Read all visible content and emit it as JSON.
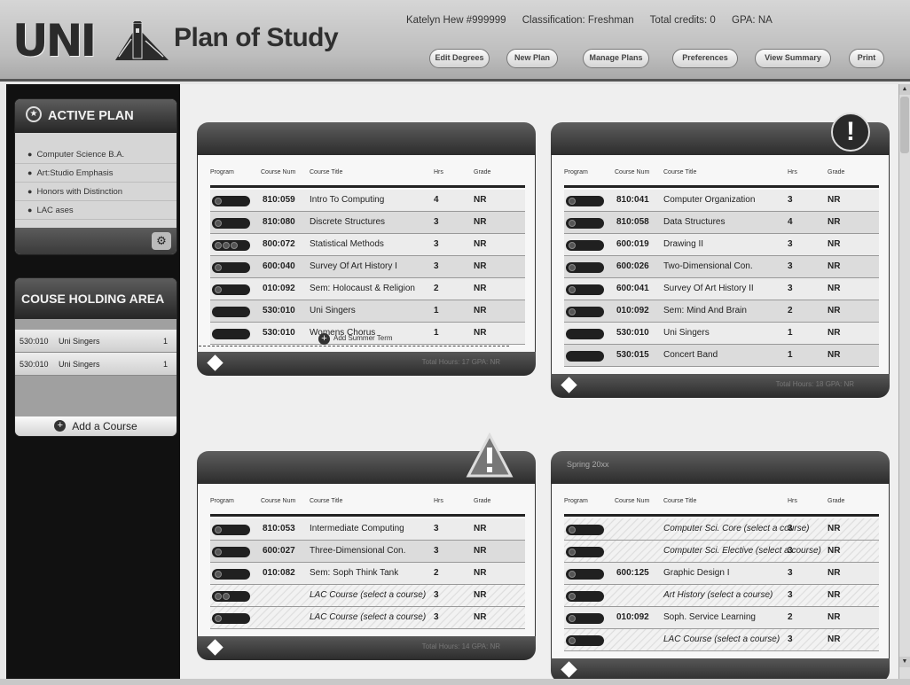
{
  "header": {
    "logo_text": "UNI",
    "title": "Plan of Study",
    "user": {
      "name": "Katelyn Hew #999999",
      "classification": "Classification: Freshman",
      "credits": "Total credits: 0",
      "gpa": "GPA: NA"
    },
    "nav": [
      "Edit Degrees",
      "New Plan",
      "Manage Plans",
      "Preferences",
      "View Summary",
      "Print"
    ]
  },
  "sidebar": {
    "active_plan": {
      "title": "ACTIVE PLAN",
      "items": [
        "Computer Science B.A.",
        "Art:Studio Emphasis",
        "Honors with Distinction",
        "LAC ases"
      ]
    },
    "holding": {
      "title": "COUSE HOLDING AREA",
      "items": [
        {
          "num": "530:010",
          "title": "Uni Singers",
          "hrs": "1"
        },
        {
          "num": "530:010",
          "title": "Uni Singers",
          "hrs": "1"
        }
      ],
      "add_label": "Add a Course"
    }
  },
  "columns": {
    "program": "Program",
    "num": "Course Num",
    "title": "Course Title",
    "hrs": "Hrs",
    "grade": "Grade"
  },
  "add_summer": "Add Summer Term",
  "terms": [
    {
      "footer": "Total Hours: 17   GPA: NR",
      "rows": [
        {
          "num": "810:059",
          "title": "Intro To Computing",
          "hrs": "4",
          "grade": "NR"
        },
        {
          "num": "810:080",
          "title": "Discrete Structures",
          "hrs": "3",
          "grade": "NR"
        },
        {
          "num": "800:072",
          "title": "Statistical Methods",
          "hrs": "3",
          "grade": "NR"
        },
        {
          "num": "600:040",
          "title": "Survey Of Art History I",
          "hrs": "3",
          "grade": "NR"
        },
        {
          "num": "010:092",
          "title": "Sem: Holocaust & Religion",
          "hrs": "2",
          "grade": "NR"
        },
        {
          "num": "530:010",
          "title": "Uni Singers",
          "hrs": "1",
          "grade": "NR"
        },
        {
          "num": "530:010",
          "title": "Womens Chorus",
          "hrs": "1",
          "grade": "NR"
        }
      ]
    },
    {
      "footer": "Total Hours: 18   GPA: NR",
      "rows": [
        {
          "num": "810:041",
          "title": "Computer Organization",
          "hrs": "3",
          "grade": "NR"
        },
        {
          "num": "810:058",
          "title": "Data Structures",
          "hrs": "4",
          "grade": "NR"
        },
        {
          "num": "600:019",
          "title": "Drawing II",
          "hrs": "3",
          "grade": "NR"
        },
        {
          "num": "600:026",
          "title": "Two-Dimensional Con.",
          "hrs": "3",
          "grade": "NR"
        },
        {
          "num": "600:041",
          "title": "Survey Of Art History II",
          "hrs": "3",
          "grade": "NR"
        },
        {
          "num": "010:092",
          "title": "Sem: Mind And Brain",
          "hrs": "2",
          "grade": "NR"
        },
        {
          "num": "530:010",
          "title": "Uni Singers",
          "hrs": "1",
          "grade": "NR"
        },
        {
          "num": "530:015",
          "title": "Concert Band",
          "hrs": "1",
          "grade": "NR"
        }
      ]
    },
    {
      "footer": "Total Hours: 14   GPA: NR",
      "rows": [
        {
          "num": "810:053",
          "title": "Intermediate Computing",
          "hrs": "3",
          "grade": "NR"
        },
        {
          "num": "600:027",
          "title": "Three-Dimensional Con.",
          "hrs": "3",
          "grade": "NR"
        },
        {
          "num": "010:082",
          "title": "Sem: Soph Think Tank",
          "hrs": "2",
          "grade": "NR"
        },
        {
          "num": "",
          "title": "LAC Course      (select a course)",
          "hrs": "3",
          "grade": "NR"
        },
        {
          "num": "",
          "title": "LAC Course      (select a course)",
          "hrs": "3",
          "grade": "NR"
        }
      ]
    },
    {
      "header": "Spring 20xx",
      "rows": [
        {
          "num": "",
          "title": "Computer Sci. Core (select a course)",
          "hrs": "3",
          "grade": "NR"
        },
        {
          "num": "",
          "title": "Computer Sci. Elective (select a course)",
          "hrs": "3",
          "grade": "NR"
        },
        {
          "num": "600:125",
          "title": "Graphic Design I",
          "hrs": "3",
          "grade": "NR"
        },
        {
          "num": "",
          "title": "Art History (select a course)",
          "hrs": "3",
          "grade": "NR"
        },
        {
          "num": "010:092",
          "title": "Soph. Service Learning",
          "hrs": "2",
          "grade": "NR"
        },
        {
          "num": "",
          "title": "LAC Course      (select a course)",
          "hrs": "3",
          "grade": "NR"
        }
      ]
    }
  ]
}
